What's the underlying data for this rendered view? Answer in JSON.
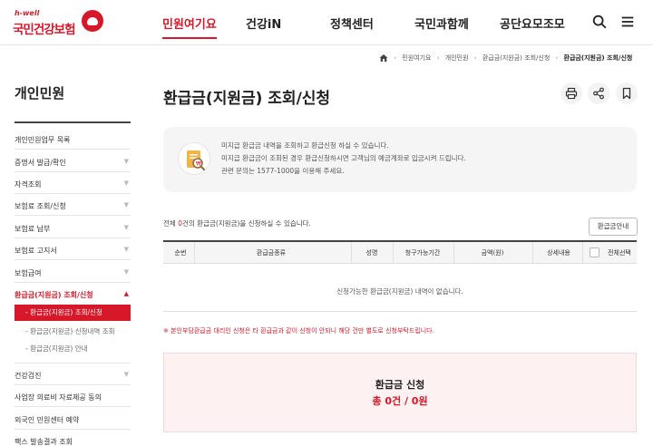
{
  "header": {
    "logo_sub": "h-well",
    "logo_main": "국민건강보험",
    "nav": [
      "민원여기요",
      "건강iN",
      "정책센터",
      "국민과함께",
      "공단요모조모"
    ],
    "active_nav": "민원여기요",
    "icons": [
      "search-icon",
      "menu-icon"
    ]
  },
  "breadcrumb": {
    "items": [
      "민원여기요",
      "개인민원",
      "환급금(지원금) 조회/신청",
      "환급금(지원금) 조회/신청"
    ]
  },
  "sidebar": {
    "title": "개인민원",
    "items": [
      {
        "label": "개인민원업무 목록",
        "has_chevron": false
      },
      {
        "label": "증명서 발급/확인",
        "has_chevron": true
      },
      {
        "label": "자격조회",
        "has_chevron": true
      },
      {
        "label": "보험료 조회/신청",
        "has_chevron": true
      },
      {
        "label": "보험료 납부",
        "has_chevron": true
      },
      {
        "label": "보험료 고지서",
        "has_chevron": true
      },
      {
        "label": "보험급여",
        "has_chevron": true
      },
      {
        "label": "환급금(지원금) 조회/신청",
        "has_chevron": true,
        "expanded": true
      }
    ],
    "subitems": [
      {
        "label": "환급금(지원금) 조회/신청",
        "selected": true
      },
      {
        "label": "환급금(지원금) 신청내역 조회",
        "selected": false
      },
      {
        "label": "환급금(지원금) 안내",
        "selected": false
      }
    ],
    "items_after": [
      {
        "label": "건강검진",
        "has_chevron": true
      },
      {
        "label": "사업장 의료비 자료제공 동의",
        "has_chevron": false
      },
      {
        "label": "외국인 민원센터 예약",
        "has_chevron": false
      },
      {
        "label": "팩스 발송결과 조회",
        "has_chevron": false
      }
    ]
  },
  "page": {
    "title": "환급금(지원금) 조회/신청",
    "tools": [
      "print-icon",
      "share-icon",
      "bookmark-icon"
    ]
  },
  "info": {
    "lines": [
      "미지급 환급금 내역을 조회하고 환급신청 하실 수 있습니다.",
      "미지급 환급금이 조회된 경우 환급신청하시면 고객님의 예금계좌로 입금시켜 드립니다.",
      "관련 문의는 1577-1000을 이용해 주세요."
    ]
  },
  "list": {
    "count_prefix": "전체 ",
    "count": "0",
    "count_suffix": "건의 환급금(지원금)을 신청하실 수 있습니다.",
    "guide_button": "환급금안내",
    "columns": [
      "순번",
      "환급금종류",
      "성명",
      "청구가능기간",
      "금액(원)",
      "상세내용",
      "전체선택"
    ],
    "empty_message": "신청가능한 환급금(지원금) 내역이 없습니다."
  },
  "notice": "※ 본인부담환급금 대리인 신청은 타 환급금과 같이 신청이 안되니 해당 건만 별도로 신청부탁드립니다.",
  "summary": {
    "label": "환급금 신청",
    "value": "총 0건 / 0원"
  },
  "colors": {
    "brand": "#d7182a",
    "summary_bg": "#fdf1f1",
    "info_bg": "#f5f5f5"
  }
}
